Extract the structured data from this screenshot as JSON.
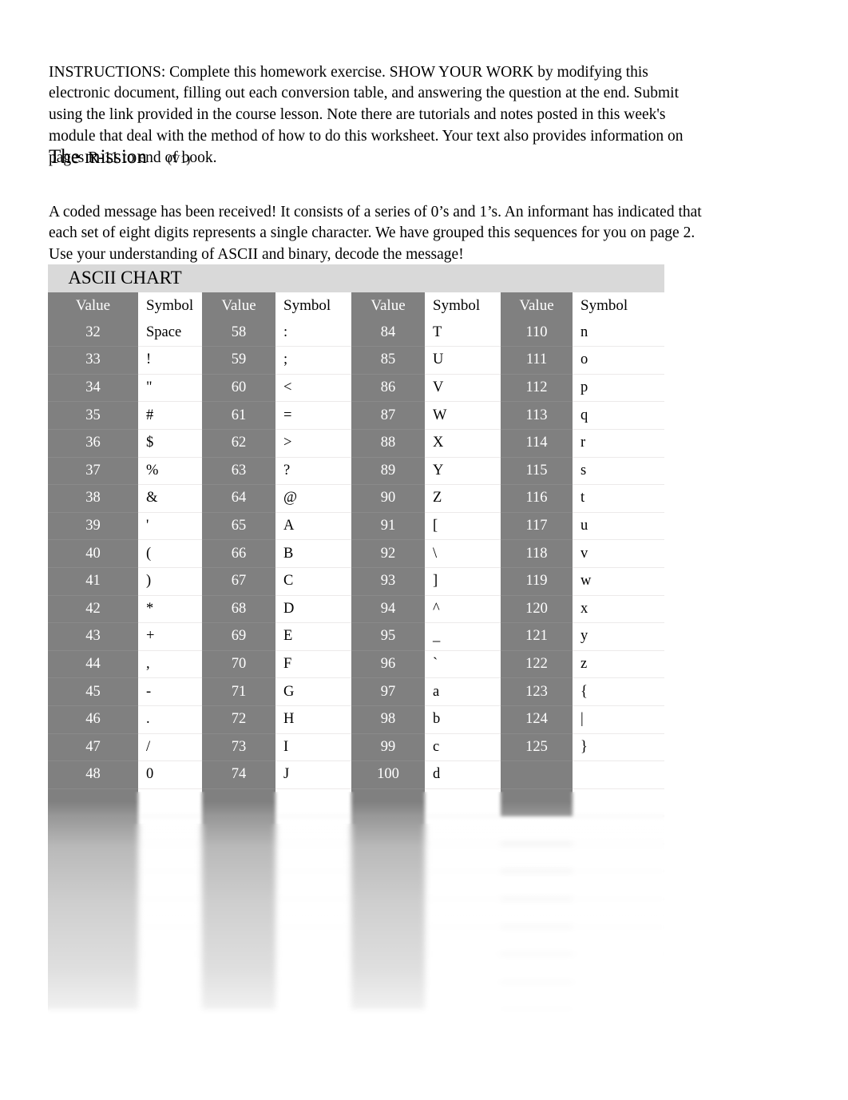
{
  "document": {
    "instructions_label": "INSTRUCTIONS:",
    "instructions_text": "INSTRUCTIONS:   Complete this homework exercise. SHOW YOUR WORK by modifying this electronic document, filling out each conversion table, and answering the question at the end. Submit using the link provided in the course lesson. Note there are tutorials and notes posted in this week's module that deal with the method of how to do this worksheet. Your text also provides information on pages R-11 to end of book.",
    "mission_heading": "The mission",
    "mission_version": "(V1)",
    "mission_text": "A coded message has been received! It consists of a series of 0’s and 1’s. An informant has indicated that each set of eight digits represents a single character. We have grouped this sequences for you on page 2. Use your understanding of ASCII and binary, decode the message!"
  },
  "ascii_chart": {
    "title": "ASCII CHART",
    "headers": [
      "Value",
      "Symbol",
      "Value",
      "Symbol",
      "Value",
      "Symbol",
      "Value",
      "Symbol"
    ],
    "colors": {
      "value_column_bg": "#808080",
      "value_column_text": "#ffffff",
      "symbol_column_bg": "#ffffff",
      "symbol_column_text": "#000000",
      "title_bg": "#d9d9d9"
    },
    "rows": [
      [
        "32",
        "Space",
        "58",
        ":",
        "84",
        "T",
        "110",
        "n"
      ],
      [
        "33",
        "!",
        "59",
        ";",
        "85",
        "U",
        "111",
        "o"
      ],
      [
        "34",
        "\"",
        "60",
        "<",
        "86",
        "V",
        "112",
        "p"
      ],
      [
        "35",
        "#",
        "61",
        "=",
        "87",
        "W",
        "113",
        "q"
      ],
      [
        "36",
        "$",
        "62",
        ">",
        "88",
        "X",
        "114",
        "r"
      ],
      [
        "37",
        "%",
        "63",
        "?",
        "89",
        "Y",
        "115",
        "s"
      ],
      [
        "38",
        "&",
        "64",
        "@",
        "90",
        "Z",
        "116",
        "t"
      ],
      [
        "39",
        "'",
        "65",
        "A",
        "91",
        "[",
        "117",
        "u"
      ],
      [
        "40",
        "(",
        "66",
        "B",
        "92",
        "\\",
        "118",
        "v"
      ],
      [
        "41",
        ")",
        "67",
        "C",
        "93",
        "]",
        "119",
        "w"
      ],
      [
        "42",
        "*",
        "68",
        "D",
        "94",
        "^",
        "120",
        "x"
      ],
      [
        "43",
        "+",
        "69",
        "E",
        "95",
        "_",
        "121",
        "y"
      ],
      [
        "44",
        ",",
        "70",
        "F",
        "96",
        "`",
        "122",
        "z"
      ],
      [
        "45",
        "-",
        "71",
        "G",
        "97",
        "a",
        "123",
        "{"
      ],
      [
        "46",
        ".",
        "72",
        "H",
        "98",
        "b",
        "124",
        "|"
      ],
      [
        "47",
        "/",
        "73",
        "I",
        "99",
        "c",
        "125",
        "}"
      ],
      [
        "48",
        "0",
        "74",
        "J",
        "100",
        "d",
        "",
        ""
      ],
      [
        "",
        "",
        "",
        "",
        "",
        "",
        "",
        ""
      ],
      [
        "",
        "",
        "",
        "",
        "",
        "",
        "",
        ""
      ],
      [
        "",
        "",
        "",
        "",
        "",
        "",
        "",
        ""
      ],
      [
        "",
        "",
        "",
        "",
        "",
        "",
        "",
        ""
      ],
      [
        "",
        "",
        "",
        "",
        "",
        "",
        "",
        ""
      ],
      [
        "",
        "",
        "",
        "",
        "",
        "",
        "",
        ""
      ],
      [
        "",
        "",
        "",
        "",
        "",
        "",
        "",
        ""
      ],
      [
        "",
        "",
        "",
        "",
        "",
        "",
        "",
        ""
      ]
    ]
  }
}
